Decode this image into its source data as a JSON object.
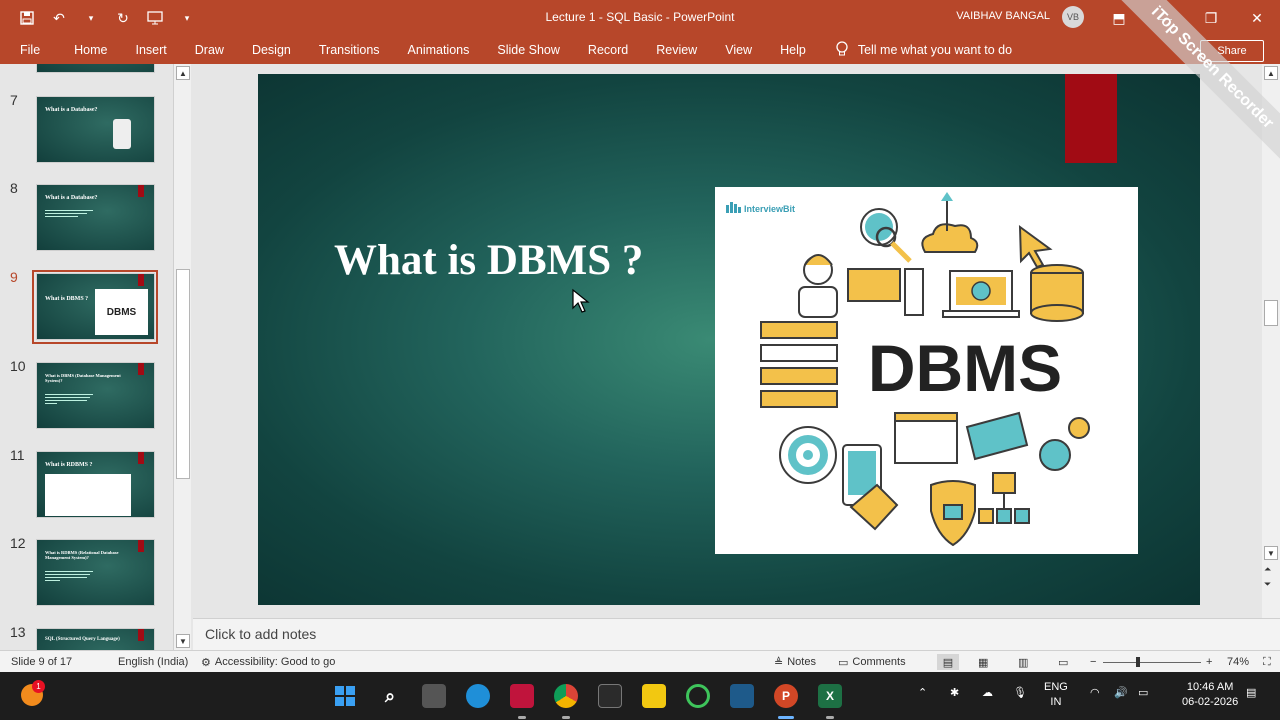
{
  "window": {
    "title": "Lecture 1 - SQL Basic  -  PowerPoint",
    "user_name": "VAIBHAV BANGAL",
    "user_initials": "VB",
    "share_label": "Share"
  },
  "ribbon": {
    "tabs": [
      "File",
      "Home",
      "Insert",
      "Draw",
      "Design",
      "Transitions",
      "Animations",
      "Slide Show",
      "Record",
      "Review",
      "View",
      "Help"
    ],
    "tell_me": "Tell me what you want to do"
  },
  "watermark": "iTop Screen Recorder",
  "thumbnails": [
    {
      "num": "7",
      "title": "What is a Database?"
    },
    {
      "num": "8",
      "title": "What is a Database?"
    },
    {
      "num": "9",
      "title": "What is DBMS ?"
    },
    {
      "num": "10",
      "title": "What is DBMS (Database Management System)?"
    },
    {
      "num": "11",
      "title": "What is RDBMS ?"
    },
    {
      "num": "12",
      "title": "What is RDBMS (Relational Database Management System)?"
    },
    {
      "num": "13",
      "title": "SQL (Structured Query Language)"
    }
  ],
  "slide": {
    "title": "What is DBMS ?",
    "image_brand": "InterviewBit",
    "image_text": "DBMS"
  },
  "notes_placeholder": "Click to add notes",
  "status": {
    "slide_counter": "Slide 9 of 17",
    "language": "English (India)",
    "accessibility": "Accessibility: Good to go",
    "notes_btn": "Notes",
    "comments_btn": "Comments",
    "zoom": "74%"
  },
  "taskbar": {
    "lang_line1": "ENG",
    "lang_line2": "IN",
    "time": "10:46 AM",
    "date": "06-02-2026",
    "badge": "1"
  }
}
